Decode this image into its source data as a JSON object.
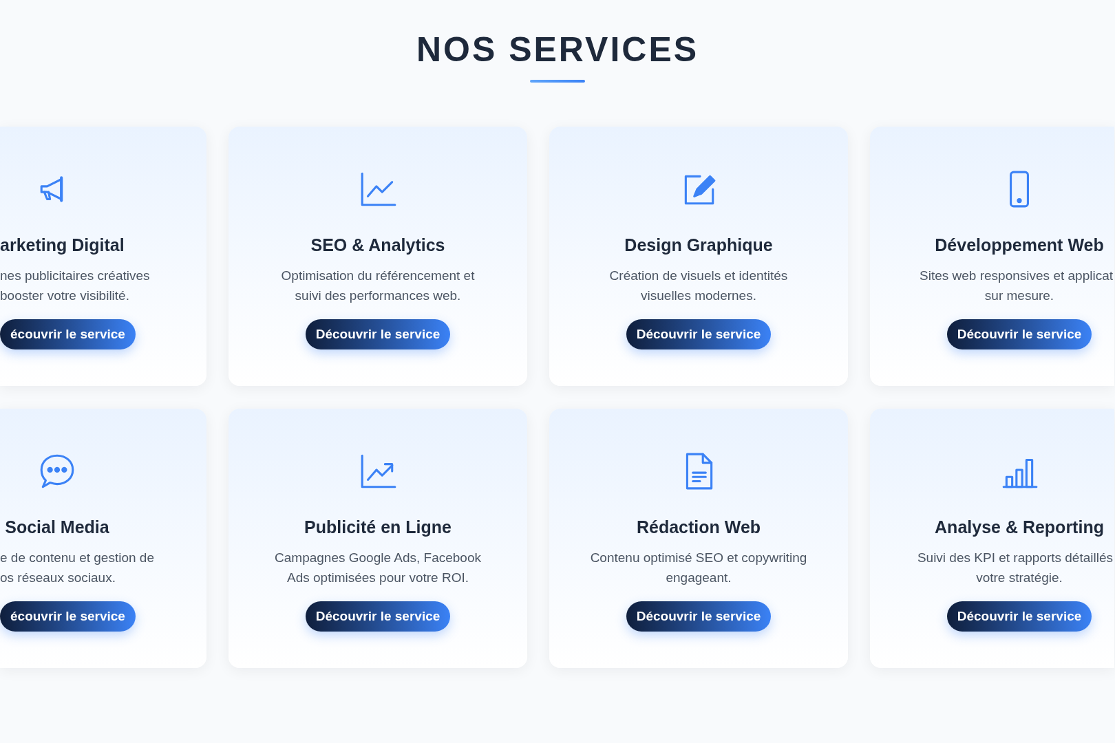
{
  "heading": "NOS SERVICES",
  "rows": [
    [
      {
        "title": "arketing Digital",
        "description_lines": [
          "nes publicitaires créatives",
          "booster votre visibilité."
        ],
        "button": "écouvrir le service"
      },
      {
        "title": "SEO & Analytics",
        "description_lines": [
          "Optimisation du référencement et",
          "suivi des performances web."
        ],
        "button": "Découvrir le service"
      },
      {
        "title": "Design Graphique",
        "description_lines": [
          "Création de visuels et identités",
          "visuelles modernes."
        ],
        "button": "Découvrir le service"
      },
      {
        "title": "Développement Web",
        "description_lines": [
          "Sites web responsives et applicat",
          "sur mesure."
        ],
        "button": "Découvrir le service"
      }
    ],
    [
      {
        "title": "Social Media",
        "description_lines": [
          "e de contenu et gestion de",
          "os réseaux sociaux."
        ],
        "button": "écouvrir le service"
      },
      {
        "title": "Publicité en Ligne",
        "description_lines": [
          "Campagnes Google Ads, Facebook",
          "Ads optimisées pour votre ROI."
        ],
        "button": "Découvrir le service"
      },
      {
        "title": "Rédaction Web",
        "description_lines": [
          "Contenu optimisé SEO et copywriting",
          "engageant."
        ],
        "button": "Découvrir le service"
      },
      {
        "title": "Analyse & Reporting",
        "description_lines": [
          "Suivi des KPI et rapports détaillés",
          "votre stratégie."
        ],
        "button": "Découvrir le service"
      }
    ]
  ]
}
